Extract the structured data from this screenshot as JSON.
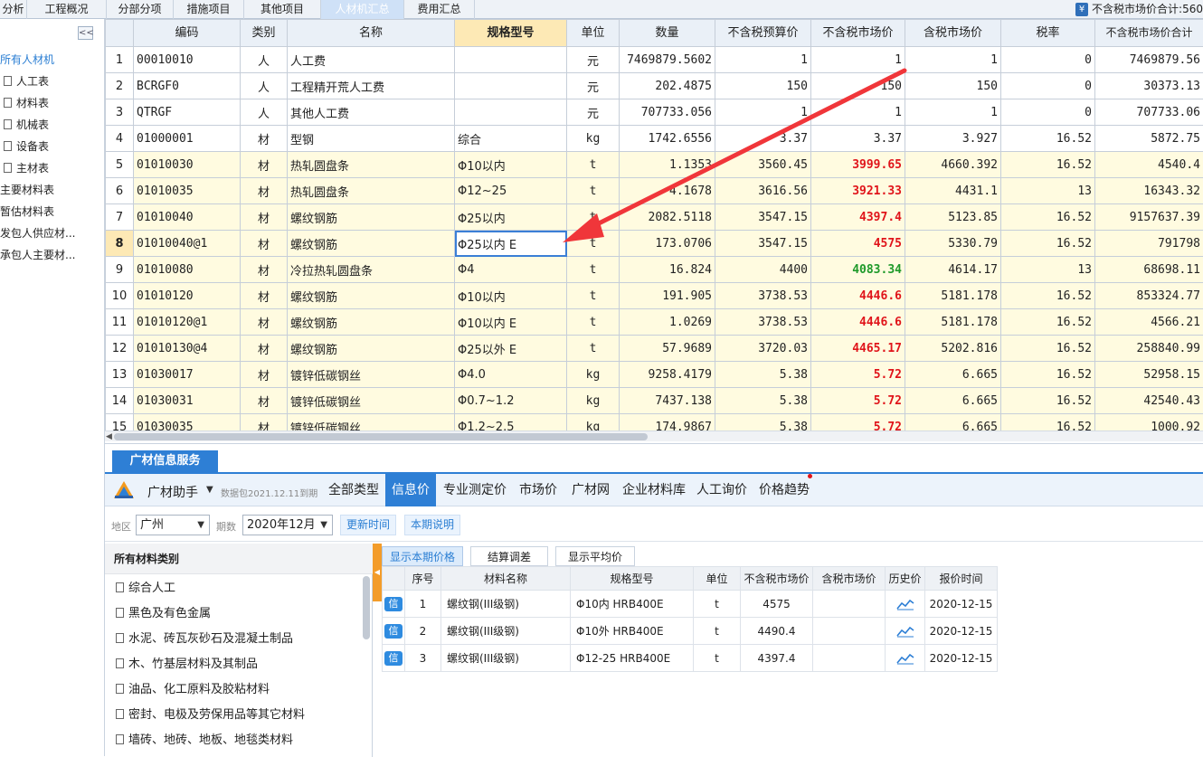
{
  "top_tabs": [
    {
      "label": "分析",
      "active": false
    },
    {
      "label": "工程概况",
      "active": false
    },
    {
      "label": "分部分项",
      "active": false
    },
    {
      "label": "措施项目",
      "active": false
    },
    {
      "label": "其他项目",
      "active": false
    },
    {
      "label": "人材机汇总",
      "active": true
    },
    {
      "label": "费用汇总",
      "active": false
    }
  ],
  "summary": {
    "label": "不含税市场价合计:",
    "value": "560"
  },
  "left_tree": {
    "collapse_label": "<<",
    "items": [
      {
        "label": "所有人材机",
        "selected": true,
        "icon": false
      },
      {
        "label": "人工表",
        "selected": false,
        "icon": true
      },
      {
        "label": "材料表",
        "selected": false,
        "icon": true
      },
      {
        "label": "机械表",
        "selected": false,
        "icon": true
      },
      {
        "label": "设备表",
        "selected": false,
        "icon": true
      },
      {
        "label": "主材表",
        "selected": false,
        "icon": true
      },
      {
        "label": "主要材料表",
        "selected": false,
        "icon": false
      },
      {
        "label": "暂估材料表",
        "selected": false,
        "icon": false
      },
      {
        "label": "发包人供应材...",
        "selected": false,
        "icon": false
      },
      {
        "label": "承包人主要材...",
        "selected": false,
        "icon": false
      }
    ]
  },
  "grid": {
    "headers": [
      "编码",
      "类别",
      "名称",
      "规格型号",
      "单位",
      "数量",
      "不含税预算价",
      "不含税市场价",
      "含税市场价",
      "税率",
      "不含税市场价合计"
    ],
    "rows": [
      {
        "no": "1",
        "code": "00010010",
        "type": "人",
        "name": "人工费",
        "spec": "",
        "unit": "元",
        "qty": "7469879.5602",
        "budget": "1",
        "market": "1",
        "market_style": "",
        "tax_market": "1",
        "rate": "0",
        "total": "7469879.56",
        "yellow": false
      },
      {
        "no": "2",
        "code": "BCRGF0",
        "type": "人",
        "name": "工程精开荒人工费",
        "spec": "",
        "unit": "元",
        "qty": "202.4875",
        "budget": "150",
        "market": "150",
        "market_style": "",
        "tax_market": "150",
        "rate": "0",
        "total": "30373.13",
        "yellow": false
      },
      {
        "no": "3",
        "code": "QTRGF",
        "type": "人",
        "name": "其他人工费",
        "spec": "",
        "unit": "元",
        "qty": "707733.056",
        "budget": "1",
        "market": "1",
        "market_style": "",
        "tax_market": "1",
        "rate": "0",
        "total": "707733.06",
        "yellow": false
      },
      {
        "no": "4",
        "code": "01000001",
        "type": "材",
        "name": "型钢",
        "spec": "综合",
        "unit": "kg",
        "qty": "1742.6556",
        "budget": "3.37",
        "market": "3.37",
        "market_style": "",
        "tax_market": "3.927",
        "rate": "16.52",
        "total": "5872.75",
        "yellow": false
      },
      {
        "no": "5",
        "code": "01010030",
        "type": "材",
        "name": "热轧圆盘条",
        "spec": "Φ10以内",
        "unit": "t",
        "qty": "1.1353",
        "budget": "3560.45",
        "market": "3999.65",
        "market_style": "red",
        "tax_market": "4660.392",
        "rate": "16.52",
        "total": "4540.4",
        "yellow": true
      },
      {
        "no": "6",
        "code": "01010035",
        "type": "材",
        "name": "热轧圆盘条",
        "spec": "Φ12~25",
        "unit": "t",
        "qty": "4.1678",
        "budget": "3616.56",
        "market": "3921.33",
        "market_style": "red",
        "tax_market": "4431.1",
        "rate": "13",
        "total": "16343.32",
        "yellow": true
      },
      {
        "no": "7",
        "code": "01010040",
        "type": "材",
        "name": "螺纹钢筋",
        "spec": "Φ25以内",
        "unit": "t",
        "qty": "2082.5118",
        "budget": "3547.15",
        "market": "4397.4",
        "market_style": "red",
        "tax_market": "5123.85",
        "rate": "16.52",
        "total": "9157637.39",
        "yellow": true
      },
      {
        "no": "8",
        "code": "01010040@1",
        "type": "材",
        "name": "螺纹钢筋",
        "spec": "Φ25以内 E",
        "unit": "t",
        "qty": "173.0706",
        "budget": "3547.15",
        "market": "4575",
        "market_style": "red",
        "tax_market": "5330.79",
        "rate": "16.52",
        "total": "791798",
        "yellow": true,
        "current": true
      },
      {
        "no": "9",
        "code": "01010080",
        "type": "材",
        "name": "冷拉热轧圆盘条",
        "spec": "Φ4",
        "unit": "t",
        "qty": "16.824",
        "budget": "4400",
        "market": "4083.34",
        "market_style": "green",
        "tax_market": "4614.17",
        "rate": "13",
        "total": "68698.11",
        "yellow": true
      },
      {
        "no": "10",
        "code": "01010120",
        "type": "材",
        "name": "螺纹钢筋",
        "spec": "Φ10以内",
        "unit": "t",
        "qty": "191.905",
        "budget": "3738.53",
        "market": "4446.6",
        "market_style": "red",
        "tax_market": "5181.178",
        "rate": "16.52",
        "total": "853324.77",
        "yellow": true
      },
      {
        "no": "11",
        "code": "01010120@1",
        "type": "材",
        "name": "螺纹钢筋",
        "spec": "Φ10以内 E",
        "unit": "t",
        "qty": "1.0269",
        "budget": "3738.53",
        "market": "4446.6",
        "market_style": "red",
        "tax_market": "5181.178",
        "rate": "16.52",
        "total": "4566.21",
        "yellow": true
      },
      {
        "no": "12",
        "code": "01010130@4",
        "type": "材",
        "name": "螺纹钢筋",
        "spec": "Φ25以外 E",
        "unit": "t",
        "qty": "57.9689",
        "budget": "3720.03",
        "market": "4465.17",
        "market_style": "red",
        "tax_market": "5202.816",
        "rate": "16.52",
        "total": "258840.99",
        "yellow": true
      },
      {
        "no": "13",
        "code": "01030017",
        "type": "材",
        "name": "镀锌低碳钢丝",
        "spec": "Φ4.0",
        "unit": "kg",
        "qty": "9258.4179",
        "budget": "5.38",
        "market": "5.72",
        "market_style": "red",
        "tax_market": "6.665",
        "rate": "16.52",
        "total": "52958.15",
        "yellow": true
      },
      {
        "no": "14",
        "code": "01030031",
        "type": "材",
        "name": "镀锌低碳钢丝",
        "spec": "Φ0.7~1.2",
        "unit": "kg",
        "qty": "7437.138",
        "budget": "5.38",
        "market": "5.72",
        "market_style": "red",
        "tax_market": "6.665",
        "rate": "16.52",
        "total": "42540.43",
        "yellow": true
      },
      {
        "no": "15",
        "code": "01030035",
        "type": "材",
        "name": "镀锌低碳钢丝",
        "spec": "Φ1.2~2.5",
        "unit": "kg",
        "qty": "174.9867",
        "budget": "5.38",
        "market": "5.72",
        "market_style": "red",
        "tax_market": "6.665",
        "rate": "16.52",
        "total": "1000.92",
        "yellow": true
      }
    ]
  },
  "service": {
    "tab_label": "广材信息服务",
    "helper_label": "广材助手",
    "package_label": "数据包2021.12.11到期",
    "source_tabs": [
      {
        "label": "全部类型",
        "active": false
      },
      {
        "label": "信息价",
        "active": true
      },
      {
        "label": "专业测定价",
        "active": false
      },
      {
        "label": "市场价",
        "active": false
      },
      {
        "label": "广材网",
        "active": false
      },
      {
        "label": "企业材料库",
        "active": false
      },
      {
        "label": "人工询价",
        "active": false
      },
      {
        "label": "价格趋势",
        "active": false
      }
    ],
    "filters": {
      "region_label": "地区",
      "region_value": "广州",
      "period_label": "期数",
      "period_value": "2020年12月",
      "update_button": "更新时间",
      "notes_button": "本期说明"
    },
    "categories": {
      "header": "所有材料类别",
      "items": [
        "综合人工",
        "黑色及有色金属",
        "水泥、砖瓦灰砂石及混凝土制品",
        "木、竹基层材料及其制品",
        "油品、化工原料及胶粘材料",
        "密封、电极及劳保用品等其它材料",
        "墙砖、地砖、地板、地毯类材料"
      ]
    },
    "sub_tabs": [
      {
        "label": "显示本期价格",
        "active": true
      },
      {
        "label": "结算调差",
        "active": false
      },
      {
        "label": "显示平均价",
        "active": false
      }
    ],
    "price_table": {
      "headers": [
        "序号",
        "材料名称",
        "规格型号",
        "单位",
        "不含税市场价",
        "含税市场价",
        "历史价",
        "报价时间"
      ],
      "badge": "信",
      "rows": [
        {
          "no": "1",
          "name": "螺纹钢(III级钢)",
          "spec": "Φ10内 HRB400E",
          "unit": "t",
          "price": "4575",
          "tax_price": "",
          "date": "2020-12-15"
        },
        {
          "no": "2",
          "name": "螺纹钢(III级钢)",
          "spec": "Φ10外 HRB400E",
          "unit": "t",
          "price": "4490.4",
          "tax_price": "",
          "date": "2020-12-15"
        },
        {
          "no": "3",
          "name": "螺纹钢(III级钢)",
          "spec": "Φ12-25 HRB400E",
          "unit": "t",
          "price": "4397.4",
          "tax_price": "",
          "date": "2020-12-15"
        }
      ]
    }
  },
  "colors": {
    "accent": "#2e7fd5",
    "header_highlight": "#fde9b5",
    "row_yellow": "#fffbe0",
    "price_up": "#e0141a",
    "price_down": "#1f9a2a",
    "orange": "#f39c2a"
  }
}
